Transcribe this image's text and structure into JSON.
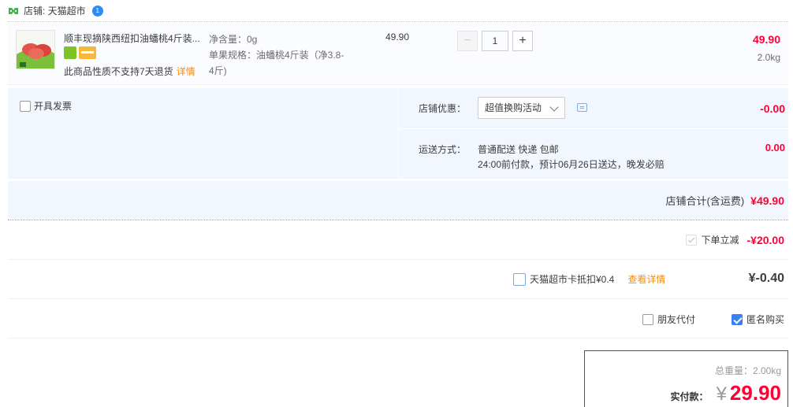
{
  "shop": {
    "label": "店铺: 天猫超市",
    "badge": "1"
  },
  "item": {
    "title": "顺丰现摘陕西纽扣油蟠桃4斤装...",
    "notice": "此商品性质不支持7天退货",
    "notice_link": "详情",
    "net_weight": "净含量：0g",
    "spec_line1": "单果规格：油蟠桃4斤装（净3.8-",
    "spec_line2": "4斤)",
    "unit_price": "49.90",
    "quantity": "1",
    "minus": "−",
    "plus": "+",
    "total": "49.90",
    "weight": "2.0kg"
  },
  "invoice": {
    "label": "开具发票"
  },
  "promo": {
    "label": "店铺优惠：",
    "selected": "超值换购活动",
    "value": "-0.00"
  },
  "shipping": {
    "label": "运送方式：",
    "line1": "普通配送 快递 包邮",
    "line2": "24:00前付款，预计06月26日送达，晚发必赔",
    "value": "0.00"
  },
  "subtotal": {
    "label": "店铺合计(含运费)",
    "value": "¥49.90"
  },
  "discount": {
    "label": "下单立减",
    "value": "-¥20.00"
  },
  "card": {
    "label": "天猫超市卡抵扣¥0.4",
    "link": "查看详情",
    "value": "¥-0.40"
  },
  "payment": {
    "friend_pay": "朋友代付",
    "anonymous": "匿名购买"
  },
  "final": {
    "weight": "总重量：2.00kg",
    "label": "实付款：",
    "currency": "¥",
    "amount": "29.90"
  },
  "colors": {
    "accent_red": "#ff0036",
    "panel_blue": "#f2f7ff",
    "link_orange": "#ff8a00",
    "check_blue": "#3b7ff4"
  }
}
